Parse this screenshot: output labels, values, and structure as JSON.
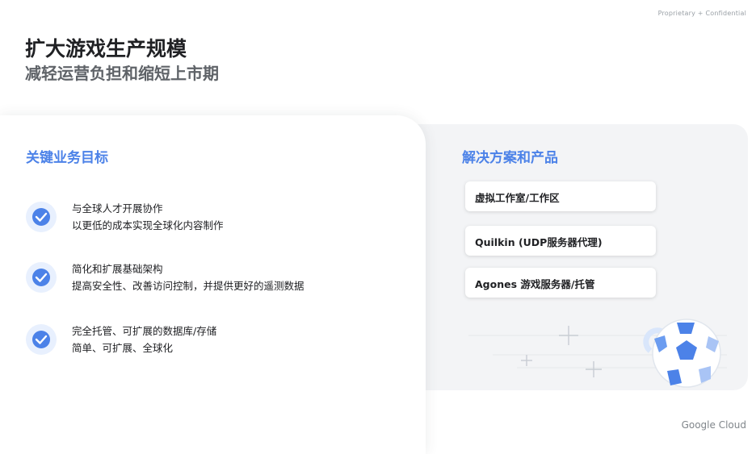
{
  "header": {
    "confidential_label": "Proprietary + Confidential",
    "title": "扩大游戏生产规模",
    "subtitle": "减轻运营负担和缩短上市期"
  },
  "goals": {
    "heading": "关键业务目标",
    "items": [
      {
        "line1": "与全球人才开展协作",
        "line2": "以更低的成本实现全球化内容制作"
      },
      {
        "line1": "简化和扩展基础架构",
        "line2": "提高安全性、改善访问控制，并提供更好的遥测数据"
      },
      {
        "line1": "完全托管、可扩展的数据库/存储",
        "line2": "简单、可扩展、全球化"
      }
    ]
  },
  "solutions": {
    "heading": "解决方案和产品",
    "items": [
      "虚拟工作室/工作区",
      "Quilkin (UDP服务器代理)",
      "Agones 游戏服务器/托管"
    ]
  },
  "footer": {
    "brand": "Google Cloud"
  },
  "colors": {
    "accent": "#4c82e8",
    "panel": "#f3f4f6",
    "badge_bg": "#e8f0fe"
  },
  "icons": {
    "check": "check-circle-icon",
    "decor": "soccer-ball-icon"
  }
}
